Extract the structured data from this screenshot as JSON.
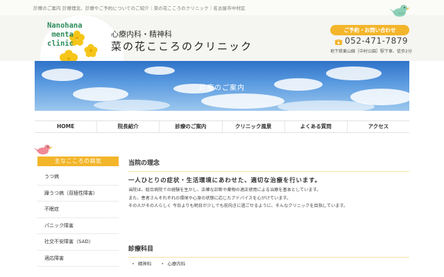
{
  "topbar": {
    "text": "診療のご案内 診療理念、診療やご予約についてのご紹介｜菜の花こころのクリニック｜名古屋市中村区"
  },
  "header": {
    "logo_text": "Nanohana\n menta\nclinic",
    "clinic_sub": "心療内科・精神科",
    "clinic_name": "菜の花こころのクリニック",
    "contact_label": "ご予約・お問い合わせ",
    "phone": "052-471-7879",
    "address": "地下鉄東山線［中村公園］駅下車、徒歩2分",
    "accent": "#f3b52a"
  },
  "hero": {
    "title": "診療のご案内"
  },
  "nav": {
    "items": [
      "HOME",
      "院長紹介",
      "診療のご案内",
      "クリニック風景",
      "よくある質問",
      "アクセス"
    ]
  },
  "sidebar": {
    "heading": "主なこころの病気",
    "items": [
      "うつ病",
      "躁うつ病（双極性障害）",
      "不眠症",
      "パニック障害",
      "社交不安障害（SAD）",
      "適応障害"
    ]
  },
  "main": {
    "section1_title": "当院の理念",
    "lead": "一人ひとりの症状・生活環境にあわせた、適切な治療を行います。",
    "paragraphs": [
      "当院は、総合病院での経験を生かし、正確な診断や薬物の適正使用による治療を基本としています。",
      "また、患者さんそれぞれの環境や心身の状態に応じたアドバイスを心がけています。",
      "その人がその人らしく 今日よりも明日が少しでも前向きに過ごせるように、そんなクリニックを目指しています。"
    ],
    "section2_title": "診療科目",
    "departments": [
      "精神科",
      "心療内科"
    ]
  }
}
